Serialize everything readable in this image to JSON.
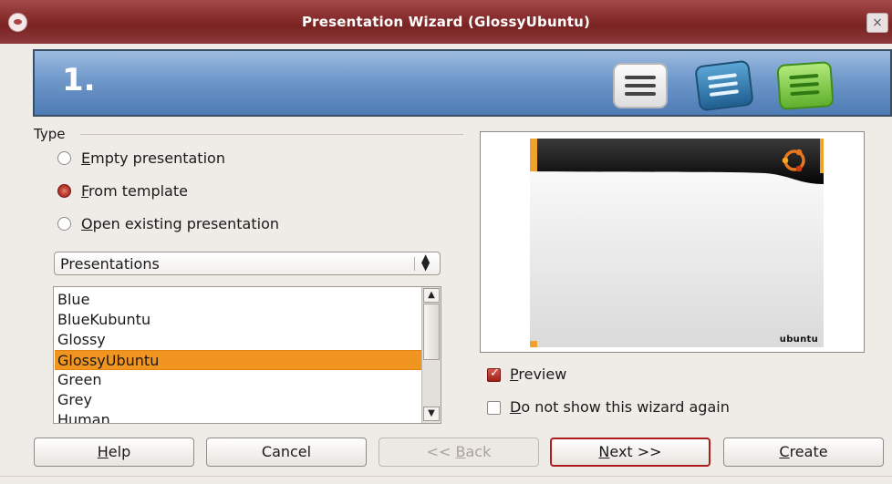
{
  "window": {
    "title": "Presentation Wizard (GlossyUbuntu)",
    "close_glyph": "×"
  },
  "banner": {
    "step": "1.",
    "icons": [
      "page-layout-icon",
      "text-layout-icon",
      "green-layout-icon"
    ]
  },
  "type": {
    "label": "Type",
    "options": [
      {
        "access": "E",
        "rest": "mpty presentation",
        "selected": false
      },
      {
        "access": "F",
        "rest": "rom template",
        "selected": true
      },
      {
        "access": "O",
        "rest": "pen existing presentation",
        "selected": false
      }
    ]
  },
  "category": {
    "selected": "Presentations"
  },
  "templates": {
    "items": [
      "Blue",
      "BlueKubuntu",
      "Glossy",
      "GlossyUbuntu",
      "Green",
      "Grey",
      "Human"
    ],
    "selected_index": 3
  },
  "preview": {
    "brand_text": "ubuntu",
    "preview_checkbox": {
      "access": "P",
      "rest": "review",
      "checked": true
    },
    "dont_show_checkbox": {
      "access": "D",
      "rest": "o not show this wizard again",
      "checked": false
    }
  },
  "buttons": {
    "help": {
      "access": "H",
      "rest": "elp"
    },
    "cancel": {
      "label": "Cancel"
    },
    "back": {
      "prefix": "<< ",
      "access": "B",
      "rest": "ack",
      "enabled": false
    },
    "next": {
      "access": "N",
      "rest": "ext >>"
    },
    "create": {
      "access": "C",
      "rest": "reate"
    }
  },
  "colors": {
    "title_bar": "#8a2f2f",
    "banner": "#6f98ca",
    "selection": "#f0951f",
    "accent": "#b01b1b"
  }
}
